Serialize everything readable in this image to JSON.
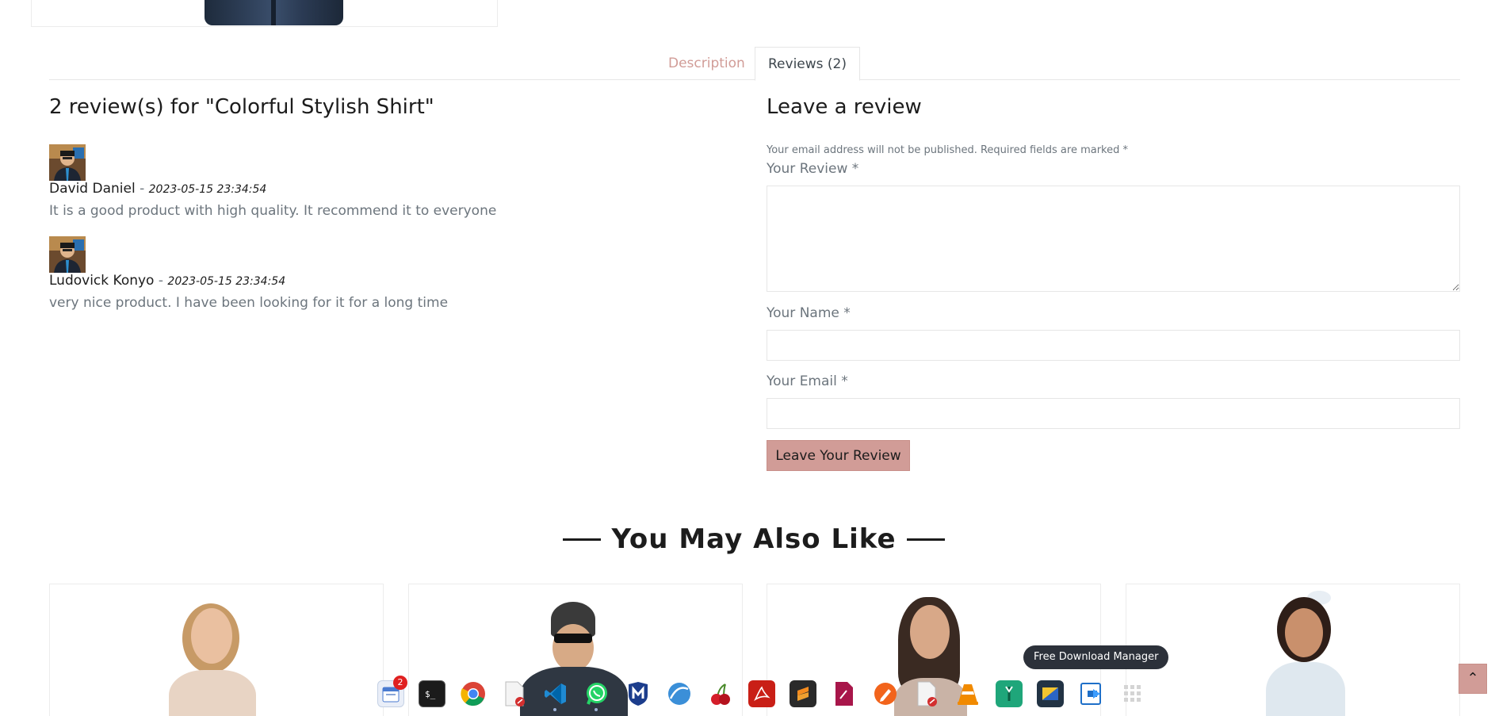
{
  "tabs": {
    "description": "Description",
    "reviews": "Reviews (2)"
  },
  "reviews_section": {
    "title": "2 review(s) for \"Colorful Stylish Shirt\"",
    "items": [
      {
        "name": "David Daniel",
        "separator": "-",
        "date": "2023-05-15 23:34:54",
        "text": "It is a good product with high quality. It recommend it to everyone"
      },
      {
        "name": "Ludovick Konyo",
        "separator": "-",
        "date": "2023-05-15 23:34:54",
        "text": "very nice product. I have been looking for it for a long time"
      }
    ]
  },
  "review_form": {
    "title": "Leave a review",
    "notice": "Your email address will not be published. Required fields are marked *",
    "review_label": "Your Review *",
    "review_value": "",
    "name_label": "Your Name *",
    "name_value": "",
    "email_label": "Your Email *",
    "email_value": "",
    "submit_label": "Leave Your Review"
  },
  "related": {
    "title": "You May Also Like"
  },
  "dock": {
    "calendar_badge": "2",
    "tooltip": "Free Download Manager"
  },
  "back_to_top": "⌃",
  "colors": {
    "accent": "#d19c97",
    "heading": "#1c1c1c",
    "muted_text": "#6c757d"
  }
}
